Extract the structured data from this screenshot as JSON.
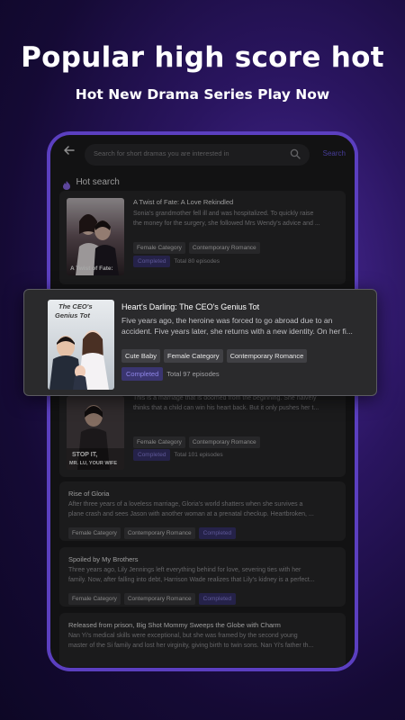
{
  "promo": {
    "headline": "Popular high score hot",
    "subheadline": "Hot New Drama Series Play Now"
  },
  "search": {
    "placeholder": "Search for short dramas you are interested in",
    "button_label": "Search"
  },
  "hot_search": {
    "title": "Hot search",
    "items": [
      {
        "title": "A Twist of Fate: A Love Rekindled",
        "description_line1": "Sonia's grandmother fell ill and was hospitalized. To quickly raise",
        "description_line2": "the money for the surgery, she followed Mrs Wendy's advice and ...",
        "tags": [
          "Female Category",
          "Contemporary Romance"
        ],
        "status": "Completed",
        "episodes": "Total 80 episodes",
        "poster_caption": "A Twist of Fate:"
      },
      {
        "title": "Heart's Darling: The CEO's Genius Tot",
        "description_line1": "Five years ago, the heroine was forced to go abroad due to an",
        "description_line2": "accident. Five years later, she returns with a new identity. On her fi...",
        "tags": [
          "Cute Baby",
          "Female Category",
          "Contemporary Romance"
        ],
        "status": "Completed",
        "episodes": "Total 97 episodes",
        "poster_caption_line1": "The CEO's",
        "poster_caption_line2": "Genius Tot"
      },
      {
        "title": "",
        "description_line1": "This is a marriage that is doomed from the beginning. She naively",
        "description_line2": "thinks that a child can win his heart back. But it only pushes her t...",
        "tags": [
          "Female Category",
          "Contemporary Romance"
        ],
        "status": "Completed",
        "episodes": "Total 101 episodes",
        "poster_caption_line1": "STOP IT,",
        "poster_caption_line2": "MR. LU, YOUR WIFE"
      },
      {
        "title": "Rise of Gloria",
        "description_line1": "After three years of a loveless marriage, Gloria's world shatters when she survives a",
        "description_line2": "plane crash and sees Jason with another woman at a prenatal checkup. Heartbroken, ...",
        "tags": [
          "Female Category",
          "Contemporary Romance"
        ],
        "status": "Completed"
      },
      {
        "title": "Spoiled by My Brothers",
        "description_line1": "Three years ago, Lily Jennings left everything behind for love, severing ties with her",
        "description_line2": "family. Now, after falling into debt, Harrison Wade realizes that Lily's kidney is a perfect...",
        "tags": [
          "Female Category",
          "Contemporary Romance"
        ],
        "status": "Completed"
      },
      {
        "title": "Released from prison, Big Shot Mommy Sweeps the Globe with Charm",
        "description_line1": "Nan Yi's medical skills were exceptional, but she was framed by the second young",
        "description_line2": "master of the Si family and lost her virginity, giving birth to twin sons. Nan Yi's father th..."
      }
    ]
  },
  "colors": {
    "accent": "#6c5ce7",
    "device_frame": "#5b3fc0",
    "card_bg": "#2a2a2c",
    "screen_bg": "#1c1c1e"
  },
  "icons": {
    "back": "back-arrow-icon",
    "search": "search-icon",
    "flame": "flame-icon"
  }
}
